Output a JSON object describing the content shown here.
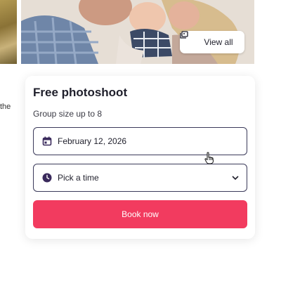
{
  "gallery": {
    "view_all_label": "View all"
  },
  "side": {
    "fragment": "the"
  },
  "booking": {
    "title": "Free photoshoot",
    "subtitle": "Group size up to 8",
    "date_value": "February 12, 2026",
    "time_value": "Pick a time",
    "book_label": "Book now"
  },
  "icons": {
    "gallery": "images-icon",
    "calendar": "calendar-icon",
    "clock": "clock-icon",
    "chevron": "chevron-down-icon",
    "cursor": "hand-pointer-icon"
  },
  "colors": {
    "accent": "#f23b5f",
    "field_border": "#3b3a5a",
    "icon_purple": "#3a2a5c"
  }
}
